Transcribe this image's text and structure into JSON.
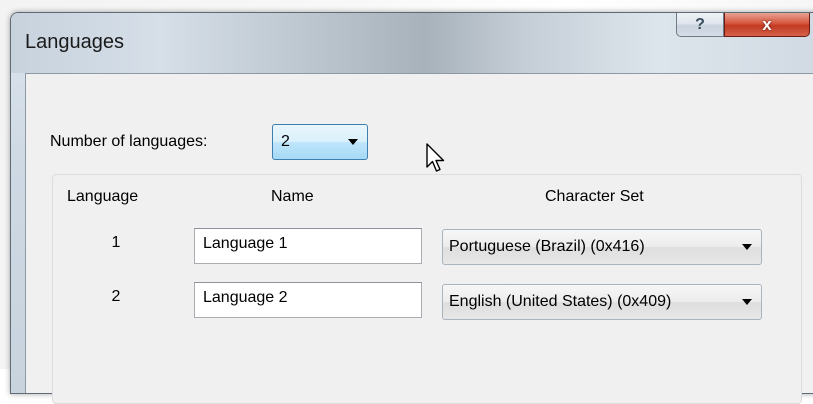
{
  "window": {
    "title": "Languages",
    "help_glyph": "?",
    "close_glyph": "x"
  },
  "number_of_languages": {
    "label": "Number of languages:",
    "selected": "2"
  },
  "table": {
    "headers": {
      "language": "Language",
      "name": "Name",
      "charset": "Character Set"
    },
    "rows": [
      {
        "number": "1",
        "name": "Language 1",
        "charset": "Portuguese (Brazil) (0x416)"
      },
      {
        "number": "2",
        "name": "Language 2",
        "charset": "English (United States) (0x409)"
      }
    ]
  },
  "colors": {
    "close_button": "#c23a21",
    "focused_combo_border": "#3c7fb1"
  },
  "icons": {
    "help": "help-question-icon",
    "close": "close-x-icon",
    "dropdown": "chevron-down-icon",
    "cursor": "mouse-pointer-icon"
  }
}
